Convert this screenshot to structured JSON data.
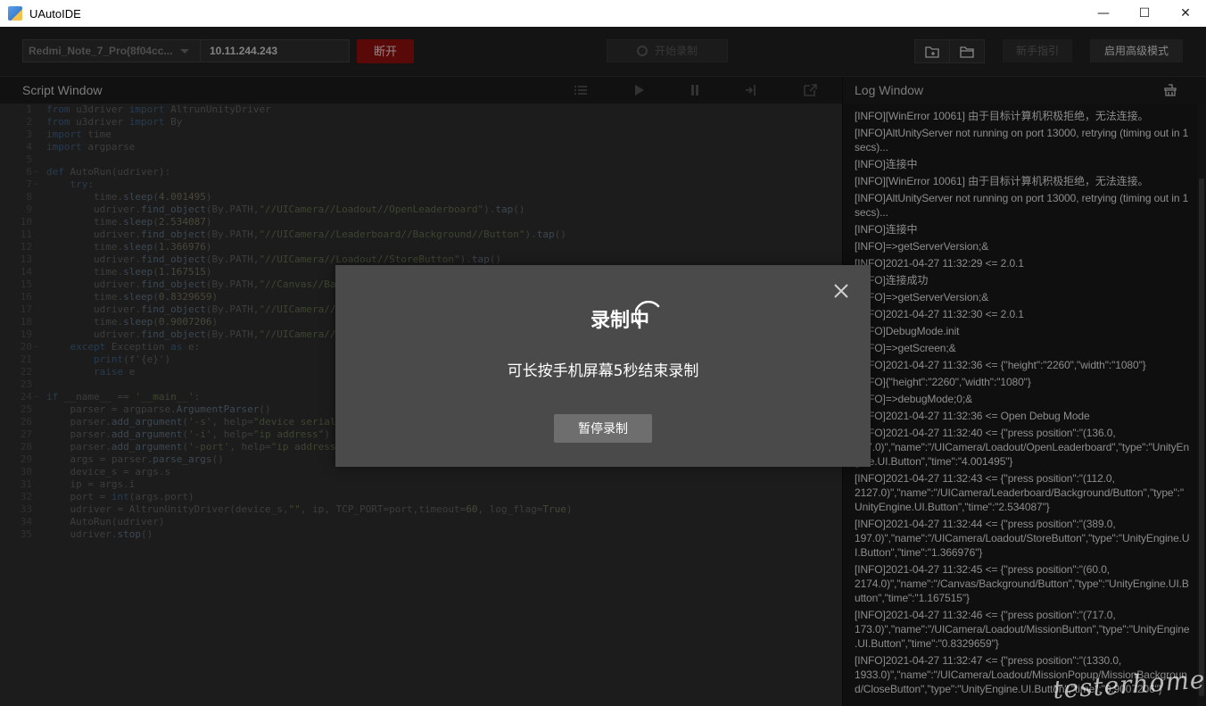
{
  "window": {
    "title": "UAutoIDE",
    "minimize_glyph": "—",
    "maximize_glyph": "☐",
    "close_glyph": "✕"
  },
  "toolbar": {
    "device": "Redmi_Note_7_Pro(8f04cc...",
    "ip": "10.11.244.243",
    "disconnect_label": "断开",
    "record_label": "开始录制",
    "guide_label": "新手指引",
    "advanced_label": "启用高级模式"
  },
  "script_panel": {
    "title": "Script Window"
  },
  "log_panel": {
    "title": "Log Window"
  },
  "code_lines": [
    {
      "n": "1",
      "fold": "",
      "t": "<span class='kw'>from</span> u3driver <span class='kw'>import</span> AltrunUnityDriver"
    },
    {
      "n": "2",
      "fold": "",
      "t": "<span class='kw'>from</span> u3driver <span class='kw'>import</span> By"
    },
    {
      "n": "3",
      "fold": "",
      "t": "<span class='kw'>import</span> time"
    },
    {
      "n": "4",
      "fold": "",
      "t": "<span class='kw'>import</span> argparse"
    },
    {
      "n": "5",
      "fold": "",
      "t": ""
    },
    {
      "n": "6",
      "fold": "−",
      "t": "<span class='kw'>def</span> AutoRun(udriver):"
    },
    {
      "n": "7",
      "fold": "−",
      "t": "    <span class='kw'>try</span>:"
    },
    {
      "n": "8",
      "fold": "",
      "t": "        time.<span class='fn'>sleep</span>(<span class='num'>4.001495</span>)"
    },
    {
      "n": "9",
      "fold": "",
      "t": "        udriver.<span class='fn'>find_object</span>(By.PATH,<span class='str'>\"//UICamera//Loadout//OpenLeaderboard\"</span>).<span class='fn'>tap</span>()"
    },
    {
      "n": "10",
      "fold": "",
      "t": "        time.<span class='fn'>sleep</span>(<span class='num'>2.534087</span>)"
    },
    {
      "n": "11",
      "fold": "",
      "t": "        udriver.<span class='fn'>find_object</span>(By.PATH,<span class='str'>\"//UICamera//Leaderboard//Background//Button\"</span>).<span class='fn'>tap</span>()"
    },
    {
      "n": "12",
      "fold": "",
      "t": "        time.<span class='fn'>sleep</span>(<span class='num'>1.366976</span>)"
    },
    {
      "n": "13",
      "fold": "",
      "t": "        udriver.<span class='fn'>find_object</span>(By.PATH,<span class='str'>\"//UICamera//Loadout//StoreButton\"</span>).<span class='fn'>tap</span>()"
    },
    {
      "n": "14",
      "fold": "",
      "t": "        time.<span class='fn'>sleep</span>(<span class='num'>1.167515</span>)"
    },
    {
      "n": "15",
      "fold": "",
      "t": "        udriver.<span class='fn'>find_object</span>(By.PATH,<span class='str'>\"//Canvas//Ba</span>"
    },
    {
      "n": "16",
      "fold": "",
      "t": "        time.<span class='fn'>sleep</span>(<span class='num'>0.8329659</span>)"
    },
    {
      "n": "17",
      "fold": "",
      "t": "        udriver.<span class='fn'>find_object</span>(By.PATH,<span class='str'>\"//UICamera//</span>"
    },
    {
      "n": "18",
      "fold": "",
      "t": "        time.<span class='fn'>sleep</span>(<span class='num'>0.9007206</span>)"
    },
    {
      "n": "19",
      "fold": "",
      "t": "        udriver.<span class='fn'>find_object</span>(By.PATH,<span class='str'>\"//UICamera//</span>"
    },
    {
      "n": "20",
      "fold": "−",
      "t": "    <span class='kw'>except</span> Exception <span class='kw'>as</span> e:"
    },
    {
      "n": "21",
      "fold": "",
      "t": "        <span class='kw'>print</span>(f'{e}')"
    },
    {
      "n": "22",
      "fold": "",
      "t": "        <span class='kw'>raise</span> e"
    },
    {
      "n": "23",
      "fold": "",
      "t": ""
    },
    {
      "n": "24",
      "fold": "−",
      "t": "<span class='kw'>if</span> __name__ == <span class='str'>'__main__'</span>:"
    },
    {
      "n": "25",
      "fold": "",
      "t": "    parser = argparse.<span class='fn'>ArgumentParser</span>()"
    },
    {
      "n": "26",
      "fold": "",
      "t": "    parser.<span class='fn'>add_argument</span>(<span class='str'>'-s'</span>, help=<span class='str'>\"device serial</span>"
    },
    {
      "n": "27",
      "fold": "",
      "t": "    parser.<span class='fn'>add_argument</span>(<span class='str'>'-i'</span>, help=<span class='str'>\"ip address\"</span>)"
    },
    {
      "n": "28",
      "fold": "",
      "t": "    parser.<span class='fn'>add_argument</span>(<span class='str'>'-port'</span>, help=<span class='str'>\"ip address</span>"
    },
    {
      "n": "29",
      "fold": "",
      "t": "    args = parser.<span class='fn'>parse_args</span>()"
    },
    {
      "n": "30",
      "fold": "",
      "t": "    device_s = args.s"
    },
    {
      "n": "31",
      "fold": "",
      "t": "    ip = args.i"
    },
    {
      "n": "32",
      "fold": "",
      "t": "    port = <span class='kw'>int</span>(args.port)"
    },
    {
      "n": "33",
      "fold": "",
      "t": "    udriver = AltrunUnityDriver(device_s,<span class='str'>\"\"</span>, ip, TCP_PORT=port,timeout=<span class='num'>60</span>, log_flag=<span class='num'>True</span>)"
    },
    {
      "n": "34",
      "fold": "",
      "t": "    AutoRun(udriver)"
    },
    {
      "n": "35",
      "fold": "",
      "t": "    udriver.<span class='fn'>stop</span>()"
    }
  ],
  "log_entries": [
    "[INFO][WinError 10061] 由于目标计算机积极拒绝，无法连接。",
    "[INFO]AltUnityServer not running on port 13000, retrying (timing out in 1 secs)...",
    "[INFO]连接中",
    "[INFO][WinError 10061] 由于目标计算机积极拒绝，无法连接。",
    "[INFO]AltUnityServer not running on port 13000, retrying (timing out in 1 secs)...",
    "[INFO]连接中",
    "[INFO]=>getServerVersion;&",
    "[INFO]2021-04-27 11:32:29 <= 2.0.1",
    "[INFO]连接成功",
    "[INFO]=>getServerVersion;&",
    "[INFO]2021-04-27 11:32:30 <= 2.0.1",
    "[INFO]DebugMode.init",
    "[INFO]=>getScreen;&",
    "[INFO]2021-04-27 11:32:36 <= {\"height\":\"2260\",\"width\":\"1080\"}",
    "[INFO]{\"height\":\"2260\",\"width\":\"1080\"}",
    "[INFO]=>debugMode;0;&",
    "[INFO]2021-04-27 11:32:36 <= Open Debug Mode",
    "[INFO]2021-04-27 11:32:40 <= {\"press position\":\"(136.0, 277.0)\",\"name\":\"/UICamera/Loadout/OpenLeaderboard\",\"type\":\"UnityEngine.UI.Button\",\"time\":\"4.001495\"}",
    "[INFO]2021-04-27 11:32:43 <= {\"press position\":\"(112.0, 2127.0)\",\"name\":\"/UICamera/Leaderboard/Background/Button\",\"type\":\"UnityEngine.UI.Button\",\"time\":\"2.534087\"}",
    "[INFO]2021-04-27 11:32:44 <= {\"press position\":\"(389.0, 197.0)\",\"name\":\"/UICamera/Loadout/StoreButton\",\"type\":\"UnityEngine.UI.Button\",\"time\":\"1.366976\"}",
    "[INFO]2021-04-27 11:32:45 <= {\"press position\":\"(60.0, 2174.0)\",\"name\":\"/Canvas/Background/Button\",\"type\":\"UnityEngine.UI.Button\",\"time\":\"1.167515\"}",
    "[INFO]2021-04-27 11:32:46 <= {\"press position\":\"(717.0, 173.0)\",\"name\":\"/UICamera/Loadout/MissionButton\",\"type\":\"UnityEngine.UI.Button\",\"time\":\"0.8329659\"}",
    "[INFO]2021-04-27 11:32:47 <= {\"press position\":\"(1330.0, 1933.0)\",\"name\":\"/UICamera/Loadout/MissionPopup/MissionBackground/CloseButton\",\"type\":\"UnityEngine.UI.Button\",\"time\":\"0.9007206\"}"
  ],
  "modal": {
    "title": "录制中",
    "subtitle": "可长按手机屏幕5秒结束录制",
    "pause_label": "暂停录制"
  },
  "watermark": "testerhome.com"
}
